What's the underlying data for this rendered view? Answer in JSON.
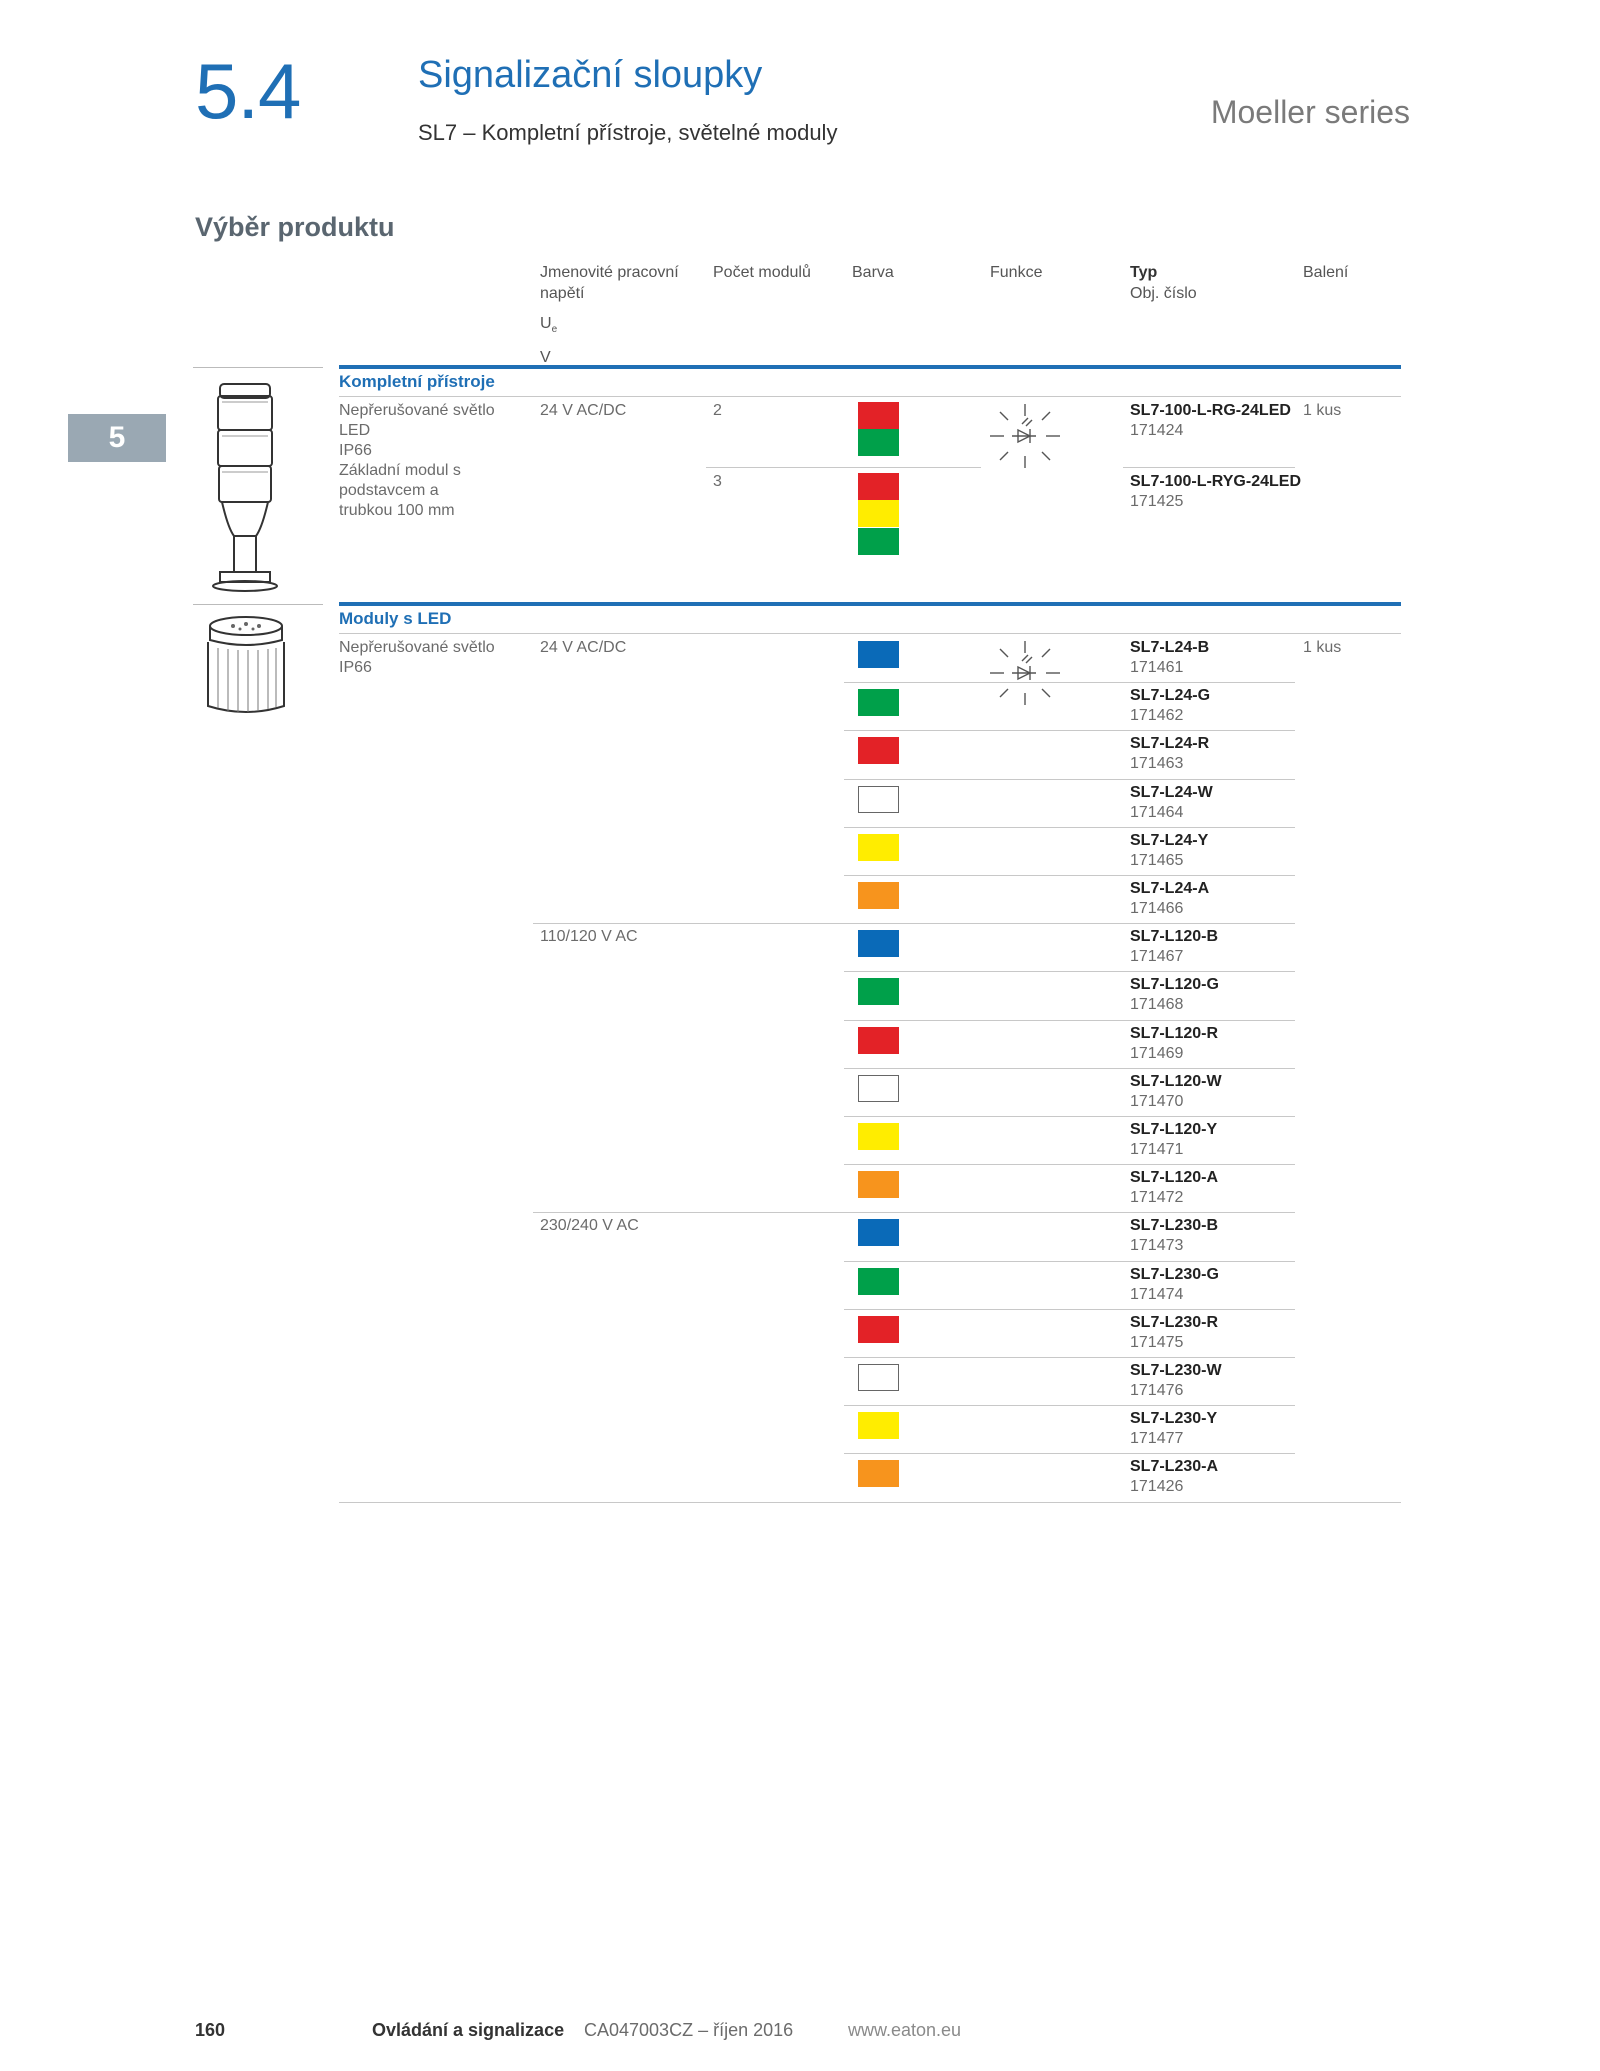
{
  "header": {
    "chapter_number": "5.4",
    "title": "Signalizační sloupky",
    "subtitle": "SL7 – Kompletní přístroje, světelné moduly",
    "series": "Moeller series"
  },
  "section_title": "Výběr produktu",
  "side_tab": "5",
  "table_header": {
    "voltage_line1": "Jmenovité pracovní",
    "voltage_line2": "napětí",
    "voltage_symbol": "U",
    "voltage_symbol_sub": "e",
    "voltage_unit": "V",
    "modules": "Počet modulů",
    "color": "Barva",
    "function": "Funkce",
    "type": "Typ",
    "order_no": "Obj. číslo",
    "packaging": "Balení"
  },
  "groups": {
    "complete": {
      "title": "Kompletní přístroje",
      "desc": [
        "Nepřerušované světlo",
        "LED",
        "IP66",
        "Základní modul s",
        "podstavcem a",
        "trubkou 100 mm"
      ],
      "voltage": "24 V AC/DC",
      "rows": [
        {
          "modules": "2",
          "type": "SL7-100-L-RG-24LED",
          "order": "171424",
          "pack": "1 kus",
          "colors": [
            "red",
            "green"
          ]
        },
        {
          "modules": "3",
          "type": "SL7-100-L-RYG-24LED",
          "order": "171425",
          "colors": [
            "red",
            "yellow",
            "green"
          ]
        }
      ]
    },
    "led": {
      "title": "Moduly s LED",
      "desc": [
        "Nepřerušované světlo",
        "IP66"
      ],
      "pack": "1 kus",
      "voltages": [
        "24 V AC/DC",
        "110/120 V AC",
        "230/240 V AC"
      ],
      "rows": [
        {
          "color": "blue",
          "type": "SL7-L24-B",
          "order": "171461"
        },
        {
          "color": "green",
          "type": "SL7-L24-G",
          "order": "171462"
        },
        {
          "color": "red",
          "type": "SL7-L24-R",
          "order": "171463"
        },
        {
          "color": "white",
          "type": "SL7-L24-W",
          "order": "171464"
        },
        {
          "color": "yellow",
          "type": "SL7-L24-Y",
          "order": "171465"
        },
        {
          "color": "orange",
          "type": "SL7-L24-A",
          "order": "171466"
        },
        {
          "color": "blue",
          "type": "SL7-L120-B",
          "order": "171467"
        },
        {
          "color": "green",
          "type": "SL7-L120-G",
          "order": "171468"
        },
        {
          "color": "red",
          "type": "SL7-L120-R",
          "order": "171469"
        },
        {
          "color": "white",
          "type": "SL7-L120-W",
          "order": "171470"
        },
        {
          "color": "yellow",
          "type": "SL7-L120-Y",
          "order": "171471"
        },
        {
          "color": "orange",
          "type": "SL7-L120-A",
          "order": "171472"
        },
        {
          "color": "blue",
          "type": "SL7-L230-B",
          "order": "171473"
        },
        {
          "color": "green",
          "type": "SL7-L230-G",
          "order": "171474"
        },
        {
          "color": "red",
          "type": "SL7-L230-R",
          "order": "171475"
        },
        {
          "color": "white",
          "type": "SL7-L230-W",
          "order": "171476"
        },
        {
          "color": "yellow",
          "type": "SL7-L230-Y",
          "order": "171477"
        },
        {
          "color": "orange",
          "type": "SL7-L230-A",
          "order": "171426"
        }
      ]
    }
  },
  "colors": {
    "accent": "#1f6fb5",
    "red": "#e32227",
    "green": "#00a04a",
    "yellow": "#ffed00",
    "blue": "#0a6ab8",
    "orange": "#f7941d",
    "white": "#ffffff"
  },
  "footer": {
    "page": "160",
    "catalog": "Ovládání a signalizace",
    "code": "CA047003CZ – říjen 2016",
    "url": "www.eaton.eu"
  }
}
